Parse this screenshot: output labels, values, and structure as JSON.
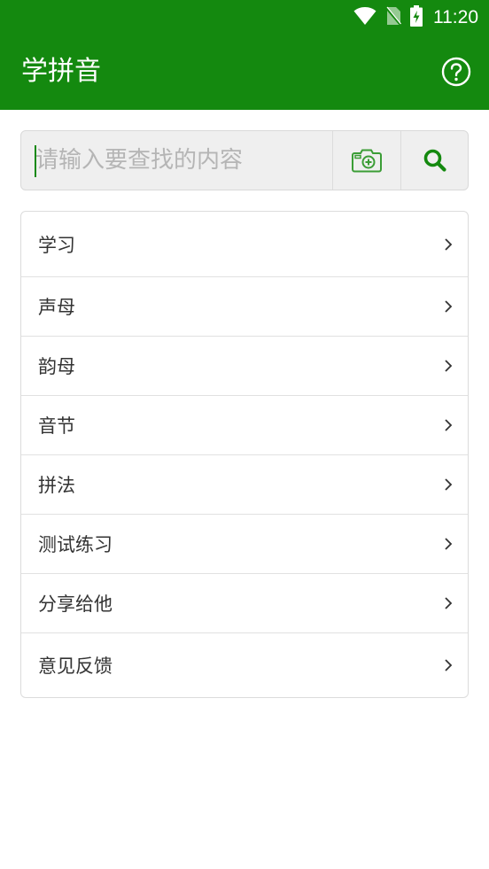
{
  "status_bar": {
    "time": "11:20",
    "icons": [
      "wifi-icon",
      "no-sim-icon",
      "battery-charging-icon"
    ]
  },
  "app_bar": {
    "title": "学拼音",
    "help_icon": "help-circle-icon"
  },
  "search": {
    "placeholder": "请输入要查找的内容",
    "value": "",
    "camera_icon": "camera-icon",
    "search_icon": "search-icon"
  },
  "menu": {
    "items": [
      {
        "label": "学习"
      },
      {
        "label": "声母"
      },
      {
        "label": "韵母"
      },
      {
        "label": "音节"
      },
      {
        "label": "拼法"
      },
      {
        "label": "测试练习"
      },
      {
        "label": "分享给他"
      },
      {
        "label": "意见反馈"
      }
    ]
  },
  "colors": {
    "primary": "#14890f",
    "background": "#ffffff",
    "search_background": "#efefef",
    "text": "#333333",
    "placeholder": "#b5b5b5"
  }
}
